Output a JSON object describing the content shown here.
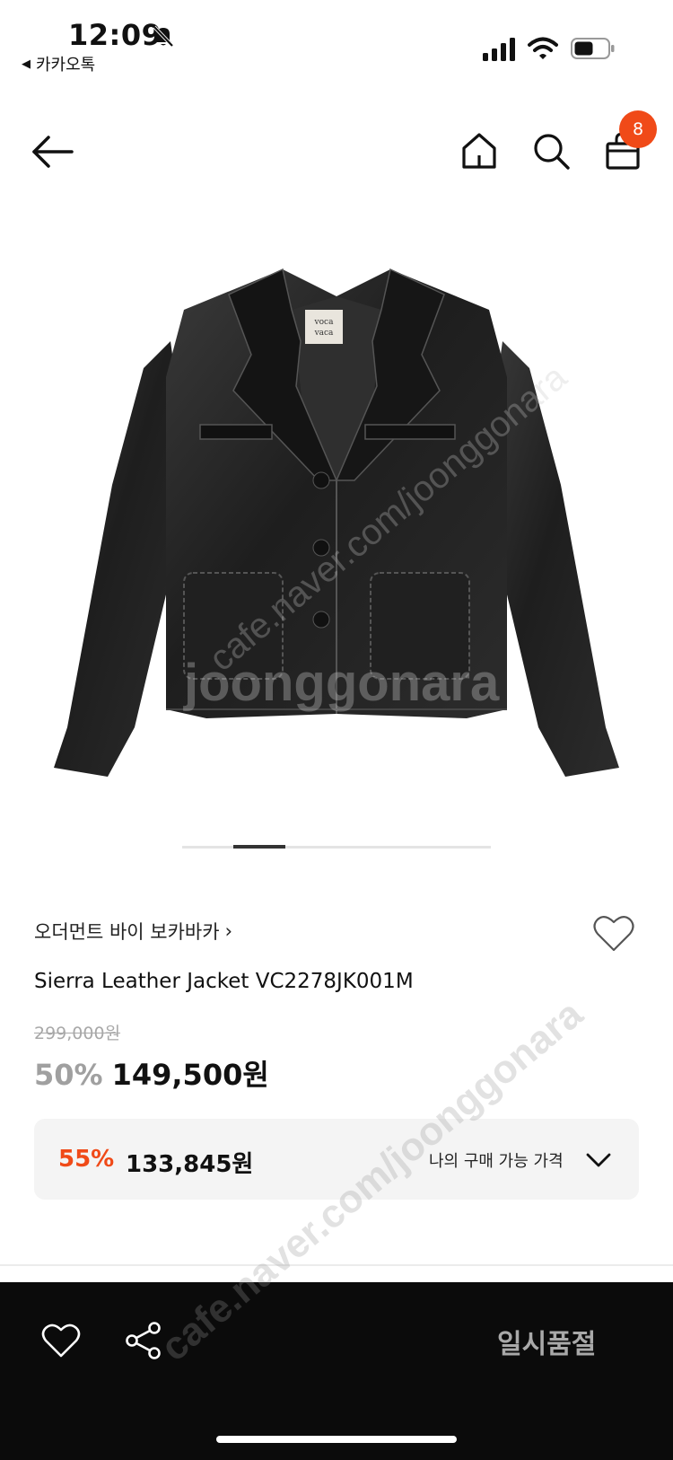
{
  "status_bar": {
    "time": "12:09",
    "back_app": "카카오톡",
    "icons": [
      "bell-muted-icon",
      "signal-icon",
      "wifi-icon",
      "battery-icon"
    ]
  },
  "header": {
    "icons": [
      "back-arrow-icon",
      "home-icon",
      "search-icon",
      "shopping-bag-icon"
    ],
    "cart_count": "8",
    "badge_color": "#f04a18"
  },
  "product": {
    "image_label": "voca vaca",
    "watermarks": [
      "cafe.naver.com/joonggonara",
      "joonggonara"
    ],
    "pager": {
      "current": 2,
      "total": 6
    },
    "brand": "오더먼트 바이 보카바카",
    "brand_chevron": "›",
    "name": "Sierra Leather Jacket VC2278JK001M",
    "original_price": "299,000원",
    "discount_percent": "50%",
    "sale_price": "149,500원",
    "my_price": {
      "discount_percent": "55%",
      "price": "133,845원",
      "label": "나의 구매 가능 가격"
    }
  },
  "bottom_bar": {
    "icons": [
      "heart-icon",
      "share-icon"
    ],
    "status": "일시품절"
  },
  "colors": {
    "accent": "#f04a18",
    "bottom_bar_bg": "#0b0b0b",
    "soldout_text": "#a9a9a9"
  }
}
